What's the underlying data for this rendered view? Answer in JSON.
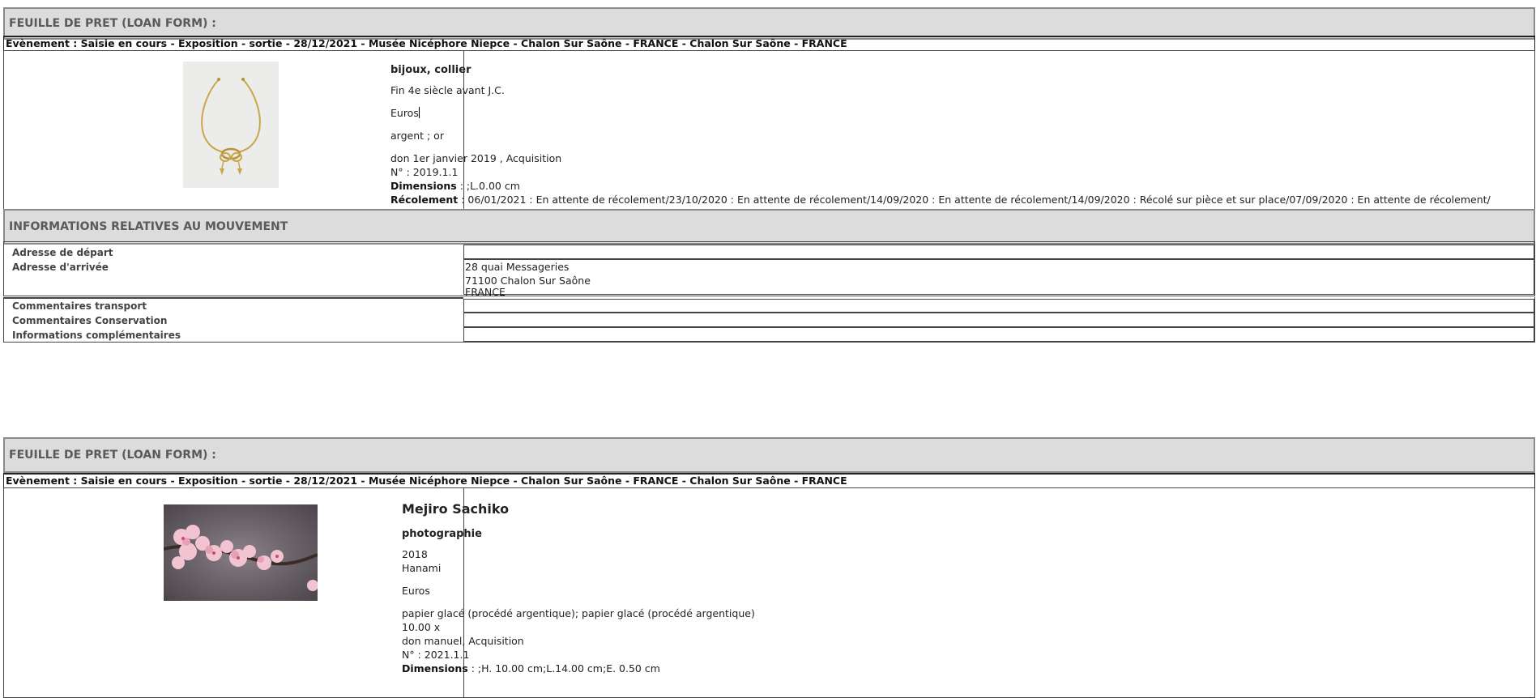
{
  "form1": {
    "title": "FEUILLE DE PRET (LOAN FORM) :",
    "event": "Evènement : Saisie en cours - Exposition - sortie - 28/12/2021 - Musée Nicéphore Niepce - Chalon Sur Saône - FRANCE - Chalon Sur Saône - FRANCE",
    "object": {
      "name": "bijoux, collier",
      "date": "Fin 4e siècle avant J.C.",
      "currency": "Euros",
      "materials": "argent ; or",
      "acquisition": "don 1er janvier 2019 , Acquisition",
      "number": "N° : 2019.1.1",
      "dimensions_label": "Dimensions",
      "dimensions_value": " : ;L.0.00 cm",
      "recolement_label": "Récolement",
      "recolement_value": " : 06/01/2021 : En attente de récolement/23/10/2020 : En attente de récolement/14/09/2020 : En attente de récolement/14/09/2020 : Récolé sur pièce et sur place/07/09/2020 : En attente de récolement/"
    },
    "movement": {
      "title": "INFORMATIONS RELATIVES AU MOUVEMENT",
      "departure_label": "Adresse de départ",
      "departure_value": "",
      "arrival_label": "Adresse d'arrivée",
      "arrival_line1": "28 quai Messageries",
      "arrival_line2": "71100 Chalon Sur Saône",
      "arrival_line3": "FRANCE",
      "transport_label": "Commentaires transport",
      "conservation_label": "Commentaires Conservation",
      "extra_label": "Informations complémentaires"
    }
  },
  "form2": {
    "title": "FEUILLE DE PRET (LOAN FORM) :",
    "event": "Evènement : Saisie en cours - Exposition - sortie - 28/12/2021 - Musée Nicéphore Niepce - Chalon Sur Saône - FRANCE - Chalon Sur Saône - FRANCE",
    "object": {
      "artist": "Mejiro Sachiko",
      "name": "photographie",
      "year": "2018",
      "title": "Hanami",
      "currency": "Euros",
      "materials": "papier glacé (procédé argentique); papier glacé (procédé argentique)",
      "size": "10.00 x",
      "acquisition": "don manuel, Acquisition",
      "number": "N° : 2021.1.1",
      "dimensions_label": "Dimensions",
      "dimensions_value": " : ;H. 10.00 cm;L.14.00 cm;E. 0.50 cm"
    }
  },
  "colors": {
    "header_bg": "#dcdcdc",
    "header_text": "#5a5a5a",
    "border": "#444444"
  }
}
